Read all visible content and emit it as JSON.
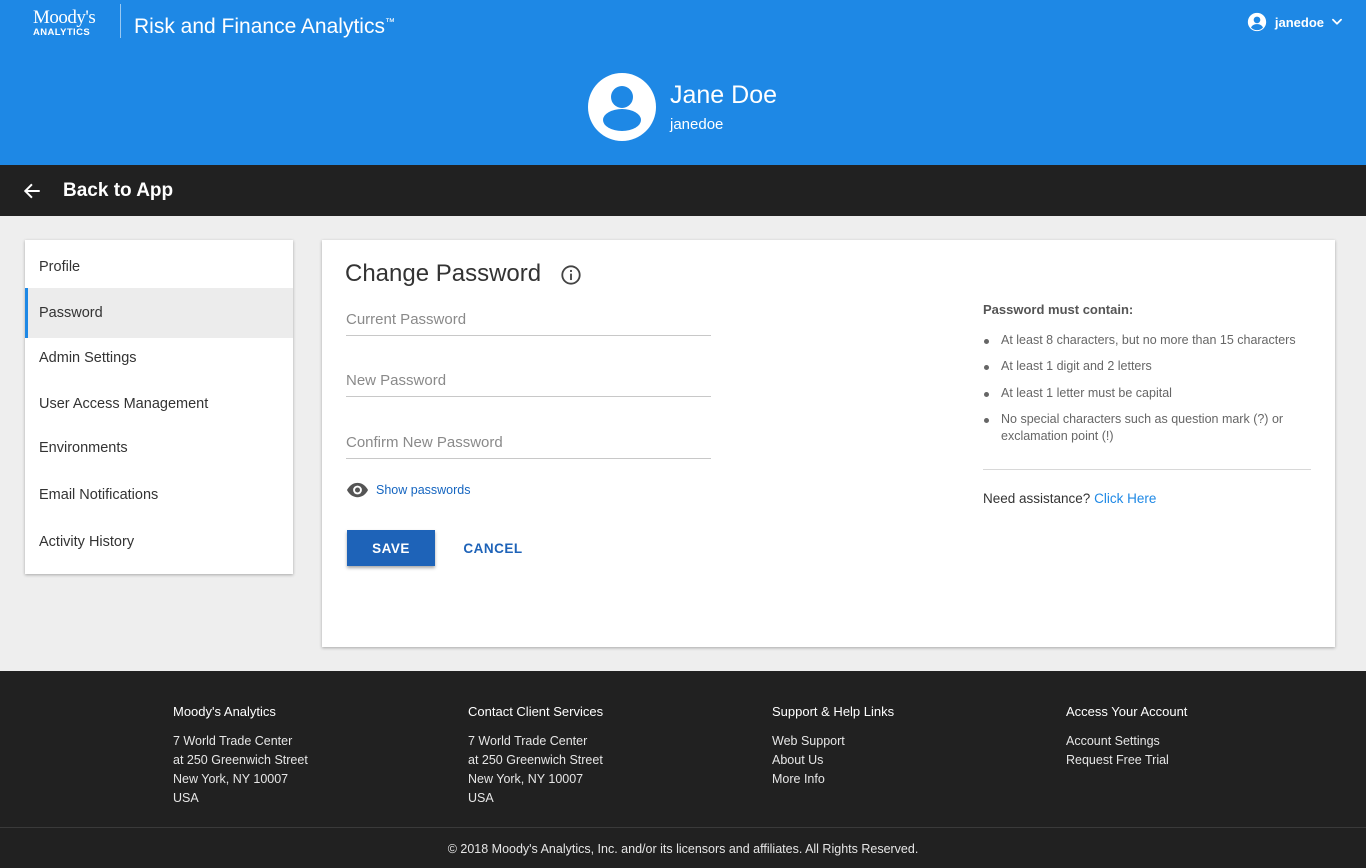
{
  "header": {
    "logo_main": "Moody's",
    "logo_sub": "ANALYTICS",
    "app_title": "Risk and Finance Analytics",
    "trademark": "™",
    "username": "janedoe",
    "background_color": "#1e88e5"
  },
  "profile": {
    "full_name": "Jane Doe",
    "username": "janedoe"
  },
  "backbar": {
    "label": "Back to App"
  },
  "sidebar": {
    "items": [
      {
        "label": "Profile",
        "active": false
      },
      {
        "label": "Password",
        "active": true
      },
      {
        "label": "Admin Settings",
        "active": false
      },
      {
        "label": "User Access Management",
        "active": false
      },
      {
        "label": "Environments",
        "active": false
      },
      {
        "label": "Email Notifications",
        "active": false
      },
      {
        "label": "Activity History",
        "active": false
      }
    ]
  },
  "change_password": {
    "title": "Change Password",
    "current_placeholder": "Current Password",
    "new_placeholder": "New Password",
    "confirm_placeholder": "Confirm New Password",
    "current_value": "",
    "new_value": "",
    "confirm_value": "",
    "show_passwords_label": "Show passwords",
    "save_label": "SAVE",
    "cancel_label": "CANCEL",
    "rules_title": "Password must contain:",
    "rules": [
      "At least 8 characters, but no more than 15 characters",
      "At least 1 digit and 2 letters",
      "At least 1 letter must be capital",
      "No special characters such as question mark (?) or exclamation point (!)"
    ],
    "assist_text": "Need assistance?",
    "assist_link": "Click Here",
    "accent_color": "#1e63b8"
  },
  "footer": {
    "columns": [
      {
        "title": "Moody's Analytics",
        "lines": [
          "7 World Trade Center",
          "at 250 Greenwich Street",
          "New York, NY 10007",
          "USA"
        ]
      },
      {
        "title": "Contact Client Services",
        "lines": [
          "7 World Trade Center",
          "at 250 Greenwich Street",
          "New York, NY 10007",
          "USA"
        ]
      },
      {
        "title": "Support & Help Links",
        "lines": [
          "Web Support",
          "About Us",
          "More Info"
        ]
      },
      {
        "title": "Access Your Account",
        "lines": [
          "Account Settings",
          "Request Free Trial"
        ]
      }
    ],
    "copyright": "© 2018 Moody's Analytics, Inc. and/or its licensors and affiliates. All Rights Reserved."
  }
}
